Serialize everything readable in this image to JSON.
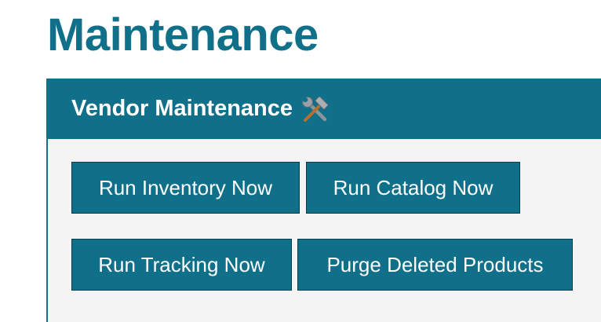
{
  "page": {
    "title": "Maintenance"
  },
  "vendor_panel": {
    "title": "Vendor Maintenance",
    "icon": "hammer-and-wrench-icon",
    "buttons": {
      "run_inventory": "Run Inventory Now",
      "run_catalog": "Run Catalog Now",
      "run_tracking": "Run Tracking Now",
      "purge_deleted": "Purge Deleted Products"
    }
  },
  "colors": {
    "accent": "#10708a",
    "button_border": "#0a3d4b",
    "panel_background": "#f4f4f4"
  }
}
